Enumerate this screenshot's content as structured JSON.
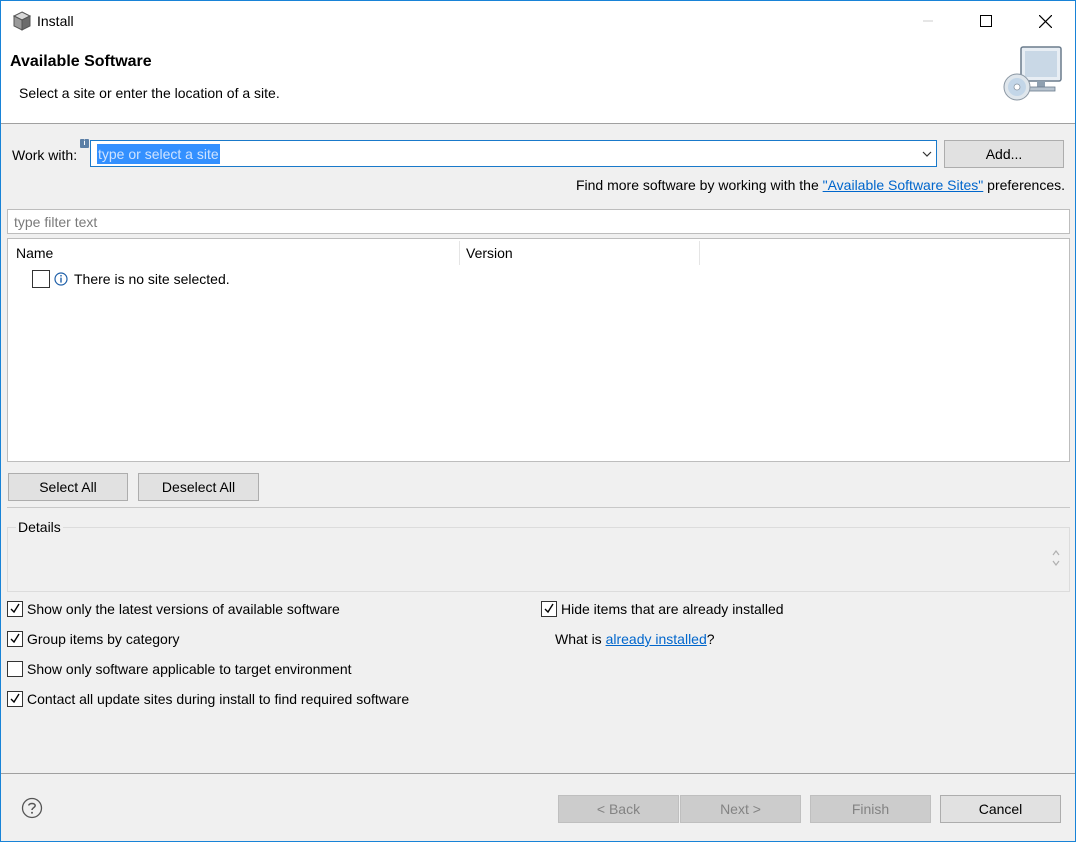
{
  "window": {
    "title": "Install",
    "app_icon": "package-icon",
    "controls": [
      "minimize-icon",
      "maximize-icon",
      "close-icon"
    ]
  },
  "banner": {
    "title": "Available Software",
    "message": "Select a site or enter the location of a site.",
    "image": "install-monitor-cd-icon"
  },
  "work_with": {
    "label": "Work with:",
    "value": "type or select a site",
    "add_button": "Add..."
  },
  "find_more": {
    "prefix": "Find more software by working with the ",
    "link": "\"Available Software Sites\"",
    "suffix": " preferences."
  },
  "filter": {
    "placeholder": "type filter text"
  },
  "tree": {
    "columns": [
      "Name",
      "Version"
    ],
    "rows": [
      {
        "checked": false,
        "icon": "info-icon",
        "text": "There is no site selected."
      }
    ]
  },
  "buttons": {
    "select_all": "Select All",
    "deselect_all": "Deselect All",
    "back": "< Back",
    "next": "Next >",
    "finish": "Finish",
    "cancel": "Cancel"
  },
  "details": {
    "label": "Details"
  },
  "options": {
    "show_latest": {
      "label": "Show only the latest versions of available software",
      "checked": true
    },
    "group_by_category": {
      "label": "Group items by category",
      "checked": true
    },
    "target_env": {
      "label": "Show only software applicable to target environment",
      "checked": false
    },
    "contact_sites": {
      "label": "Contact all update sites during install to find required software",
      "checked": true
    },
    "hide_installed": {
      "label": "Hide items that are already installed",
      "checked": true
    }
  },
  "already_installed": {
    "prefix": "What is ",
    "link": "already installed",
    "suffix": "?"
  },
  "colors": {
    "accent": "#1979ca",
    "link": "#0066cc",
    "selection": "#3390ff",
    "dialog_bg": "#f0f0f0"
  }
}
